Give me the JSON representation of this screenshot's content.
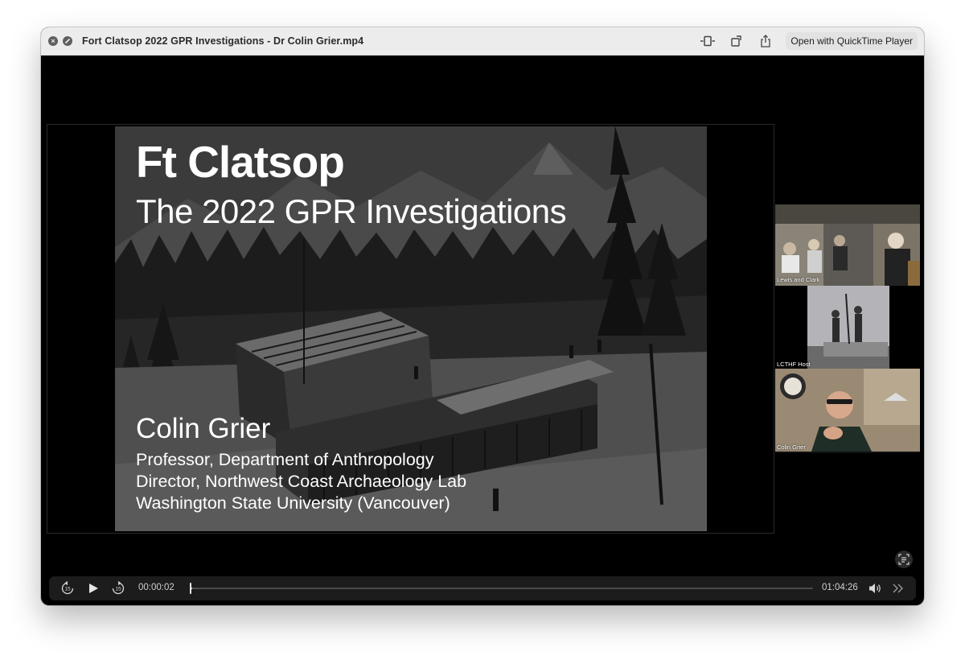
{
  "window": {
    "title": "Fort Clatsop 2022 GPR Investigations - Dr Colin Grier.mp4",
    "open_with_label": "Open with QuickTime Player",
    "close_icon": "close-icon",
    "minimize_icon": "minimize-icon"
  },
  "slide": {
    "title": "Ft Clatsop",
    "subtitle": "The 2022 GPR Investigations",
    "presenter_name": "Colin Grier",
    "presenter_lines": [
      "Professor, Department of Anthropology",
      "Director, Northwest Coast Archaeology Lab",
      "Washington State University (Vancouver)"
    ]
  },
  "participants": [
    {
      "label": "Lewis and Clark"
    },
    {
      "label": "LCTHF Host"
    },
    {
      "label": "Colin Grier"
    }
  ],
  "controls": {
    "current_time": "00:00:02",
    "total_time": "01:04:26",
    "skip_back_label": "15",
    "skip_forward_label": "15",
    "progress": 0.0005
  },
  "colors": {
    "titlebar": "#ececec",
    "video_bg": "#000000",
    "slide_bg": "#3b3b3b",
    "controls_bg": "#1c1c1c"
  }
}
